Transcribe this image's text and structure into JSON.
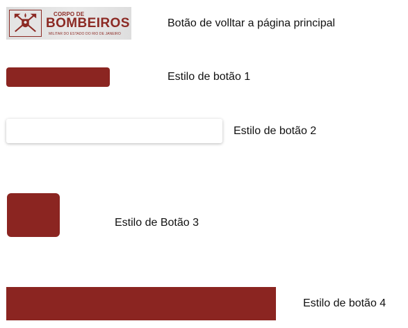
{
  "logo": {
    "line1": "CORPO DE",
    "line2": "BOMBEIROS",
    "line3": "MILITAR DO ESTADO DO RIO DE JANEIRO"
  },
  "labels": {
    "back_to_main": "Botão de volltar a página principal",
    "style1": "Estilo de botão 1",
    "style2": "Estilo de botão 2",
    "style3": "Estilo de Botão 3",
    "style4": "Estilo de botão 4"
  },
  "colors": {
    "brand_red": "#8b2521",
    "button_white": "#ffffff",
    "logo_background": "#e3e3e3"
  },
  "icons": {
    "logo_emblem": "firefighter-axes-shield-icon"
  }
}
